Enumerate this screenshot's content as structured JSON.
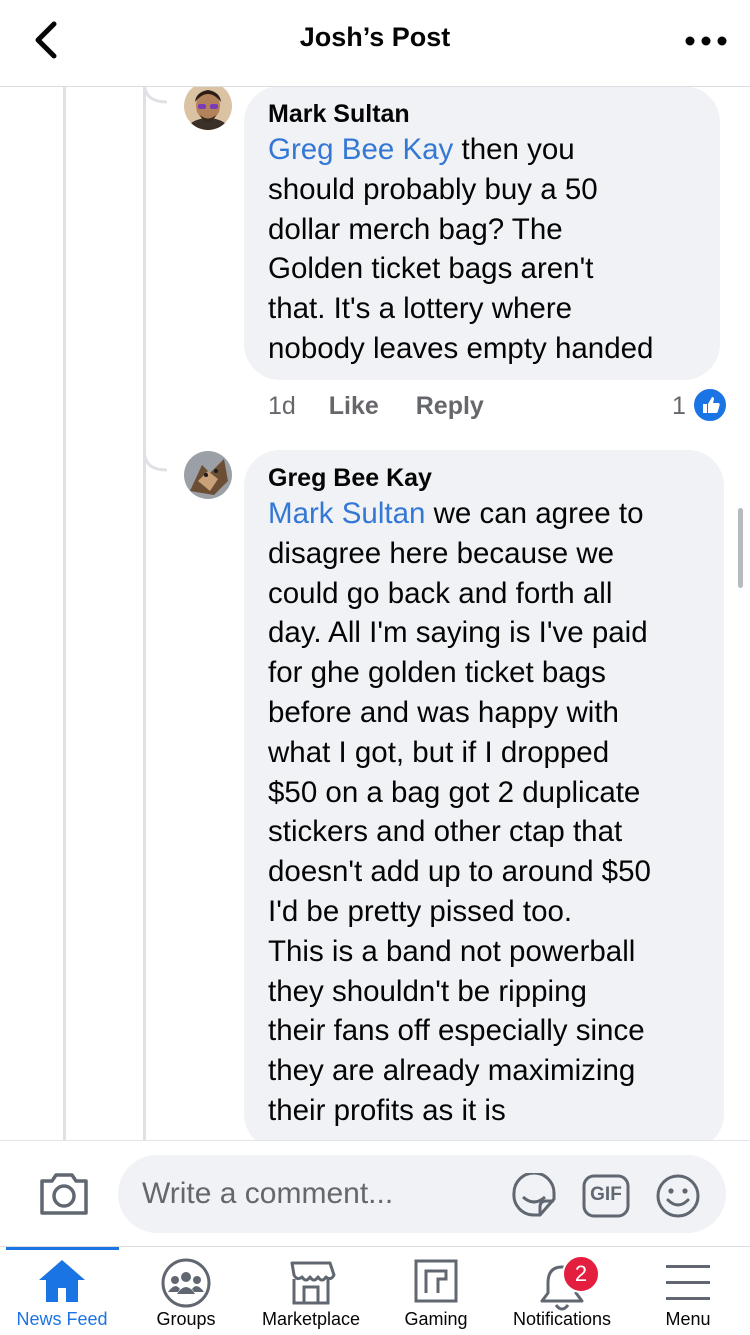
{
  "header": {
    "title": "Josh’s Post",
    "back_icon": "chevron-left-icon",
    "more_icon": "more-dots-icon"
  },
  "comments": [
    {
      "author": "Mark Sultan",
      "mention": "Greg Bee Kay",
      "text_lines": [
        " then you",
        "should probably buy a 50",
        "dollar merch bag? The",
        "Golden ticket bags aren't",
        "that. It's a lottery where",
        "nobody leaves empty handed"
      ],
      "time": "1d",
      "like_label": "Like",
      "reply_label": "Reply",
      "reaction_count": "1"
    },
    {
      "author": "Greg Bee Kay",
      "mention": "Mark Sultan",
      "text_lines": [
        " we can agree to",
        "disagree here  because we",
        "could go back and forth all",
        "day. All I'm saying is I've paid",
        "for ghe golden ticket bags",
        "before and was happy with",
        "what I got, but if I dropped",
        "$50 on a bag got 2 duplicate",
        "stickers and other ctap that",
        "doesn't add up to around $50",
        "I'd be pretty pissed too.",
        "This is a band not powerball",
        "they shouldn't be ripping",
        "their fans off especially since",
        "they are already maximizing",
        "their profits as it is"
      ]
    }
  ],
  "composer": {
    "placeholder": "Write a comment...",
    "gif_label": "GIF"
  },
  "tabs": [
    {
      "label": "News Feed",
      "icon": "home-icon",
      "active": true
    },
    {
      "label": "Groups",
      "icon": "groups-icon"
    },
    {
      "label": "Marketplace",
      "icon": "marketplace-icon"
    },
    {
      "label": "Gaming",
      "icon": "gaming-icon"
    },
    {
      "label": "Notifications",
      "icon": "bell-icon",
      "badge": "2"
    },
    {
      "label": "Menu",
      "icon": "menu-icon"
    }
  ],
  "colors": {
    "accent": "#1b74e4",
    "mention": "#3478d6",
    "bubble": "#f0f2f5",
    "badge": "#e41e3f"
  }
}
